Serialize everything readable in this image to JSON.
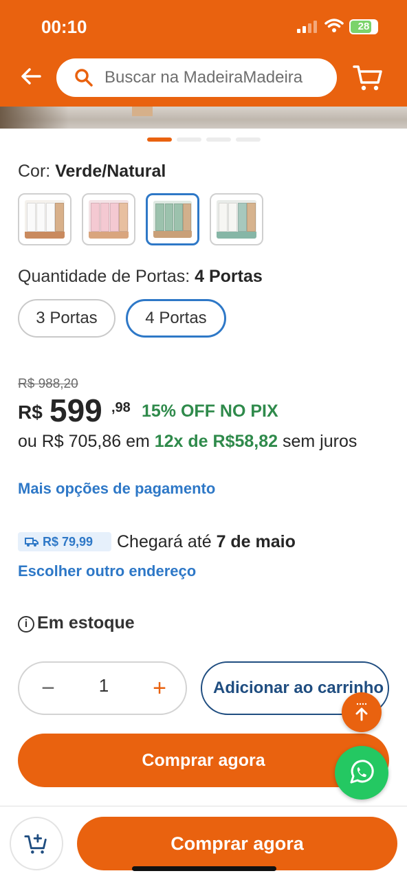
{
  "status_bar": {
    "time": "00:10",
    "battery": "28"
  },
  "header": {
    "search_placeholder": "Buscar na MadeiraMadeira"
  },
  "carousel": {
    "total": 4,
    "active": 1
  },
  "color": {
    "label": "Cor:",
    "value": "Verde/Natural",
    "selected_index": 2
  },
  "doors": {
    "label": "Quantidade de Portas:",
    "value": "4 Portas",
    "options": [
      "3 Portas",
      "4 Portas"
    ],
    "selected_index": 1
  },
  "price": {
    "old": "R$ 988,20",
    "currency": "R$",
    "integer": "599",
    "cents": ",98",
    "pix_discount": "15% OFF NO PIX",
    "installment_prefix": "ou R$ 705,86 em",
    "installment_highlight": "12x de R$58,82",
    "installment_suffix": "sem juros",
    "more_options": "Mais opções de pagamento"
  },
  "shipping": {
    "cost": "R$ 79,99",
    "delivery_prefix": "Chegará até",
    "delivery_date": "7 de maio",
    "change_address": "Escolher outro endereço"
  },
  "stock": {
    "label": "Em estoque",
    "info_glyph": "i"
  },
  "purchase": {
    "quantity": "1",
    "minus": "−",
    "plus": "+",
    "add_to_cart": "Adicionar ao carrinho",
    "buy_now": "Comprar agora"
  },
  "bottom_bar": {
    "buy_now": "Comprar agora"
  },
  "colors": {
    "brand_orange": "#e9620f",
    "link_blue": "#2e78c7",
    "pix_green": "#2f8a4b",
    "whatsapp_green": "#24c862"
  }
}
